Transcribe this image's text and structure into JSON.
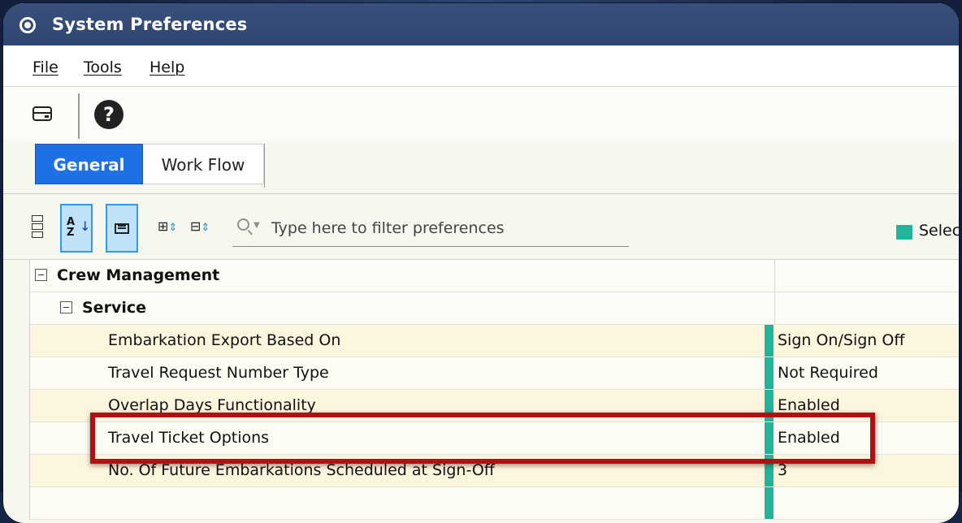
{
  "window": {
    "title": "System Preferences"
  },
  "menu": {
    "file": "File",
    "tools": "Tools",
    "help": "Help"
  },
  "toolbar": {
    "help_symbol": "?"
  },
  "tabs": {
    "general": "General",
    "workflow": "Work Flow"
  },
  "filter": {
    "placeholder": "Type here to filter preferences",
    "legend_label": "Select",
    "legend_color": "#22b39b",
    "sort_label": "A\nZ"
  },
  "grid": {
    "group": "Crew Management",
    "subgroup": "Service",
    "rows": [
      {
        "label": "Embarkation Export Based On",
        "value": "Sign On/Sign Off"
      },
      {
        "label": "Travel Request Number Type",
        "value": "Not Required"
      },
      {
        "label": "Overlap Days Functionality",
        "value": "Enabled"
      },
      {
        "label": "Travel Ticket Options",
        "value": "Enabled"
      },
      {
        "label": "No. Of Future Embarkations Scheduled at Sign-Off",
        "value": "3"
      }
    ]
  },
  "highlight": {
    "color": "#b30e12"
  }
}
